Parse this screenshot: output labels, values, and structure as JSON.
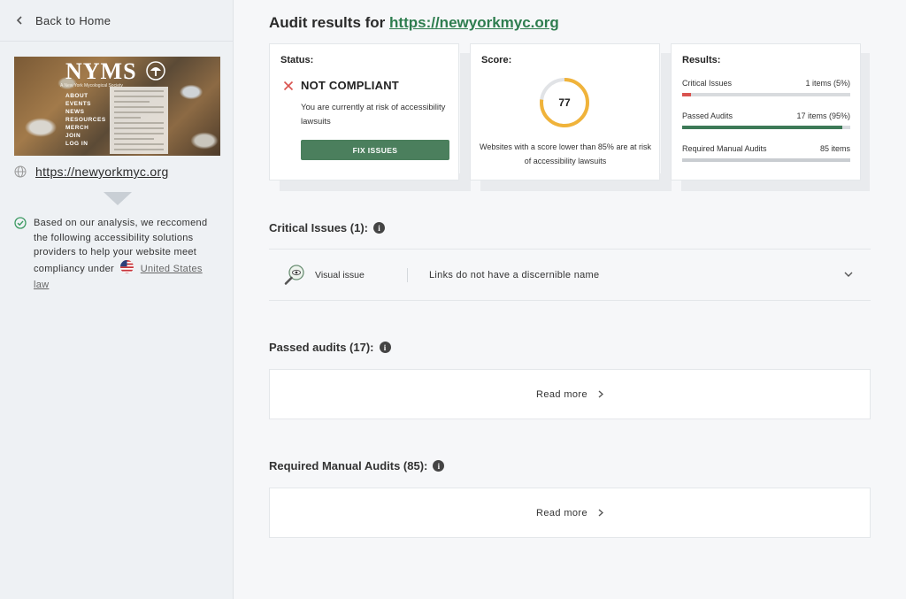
{
  "sidebar": {
    "back_label": "Back to Home",
    "preview": {
      "logo": "NYMS",
      "subtitle": "A New York Mycological Society",
      "menu": [
        "ABOUT",
        "EVENTS",
        "NEWS",
        "RESOURCES",
        "MERCH",
        "JOIN",
        "LOG IN"
      ]
    },
    "site_url": "https://newyorkmyc.org",
    "recommendation": "Based on our analysis, we reccomend the following accessibility solutions providers to help your website meet compliancy under",
    "law_link": "United States law"
  },
  "main": {
    "title_prefix": "Audit results for",
    "title_url": "https://newyorkmyc.org",
    "status": {
      "title": "Status:",
      "value": "NOT COMPLIANT",
      "description": "You are currently at risk of accessibility lawsuits",
      "fix_button": "FIX ISSUES"
    },
    "score": {
      "title": "Score:",
      "value": "77",
      "percent": 77,
      "description": "Websites with a score lower than 85% are at risk of accessibility lawsuits"
    },
    "results": {
      "title": "Results:",
      "rows": [
        {
          "label": "Critical Issues",
          "value": "1 items (5%)",
          "fraction": 0.05,
          "color": "#d9534f"
        },
        {
          "label": "Passed Audits",
          "value": "17 items (95%)",
          "fraction": 0.95,
          "color": "#3d7a57"
        },
        {
          "label": "Required Manual Audits",
          "value": "85 items",
          "fraction": 1.0,
          "color": "#c9cdd1"
        }
      ]
    },
    "critical_section": {
      "heading": "Critical Issues (1):",
      "issue": {
        "type": "Visual issue",
        "name": "Links do not have a discernible name",
        "icon": "magnifier-eye-icon"
      }
    },
    "passed_section": {
      "heading": "Passed audits (17):",
      "read_more": "Read more"
    },
    "manual_section": {
      "heading": "Required Manual Audits (85):",
      "read_more": "Read more"
    },
    "colors": {
      "accent_green": "#2e7d4f",
      "button_green": "#4b7f5d",
      "error_red": "#d9534f",
      "gauge_orange": "#f0b33a"
    }
  }
}
